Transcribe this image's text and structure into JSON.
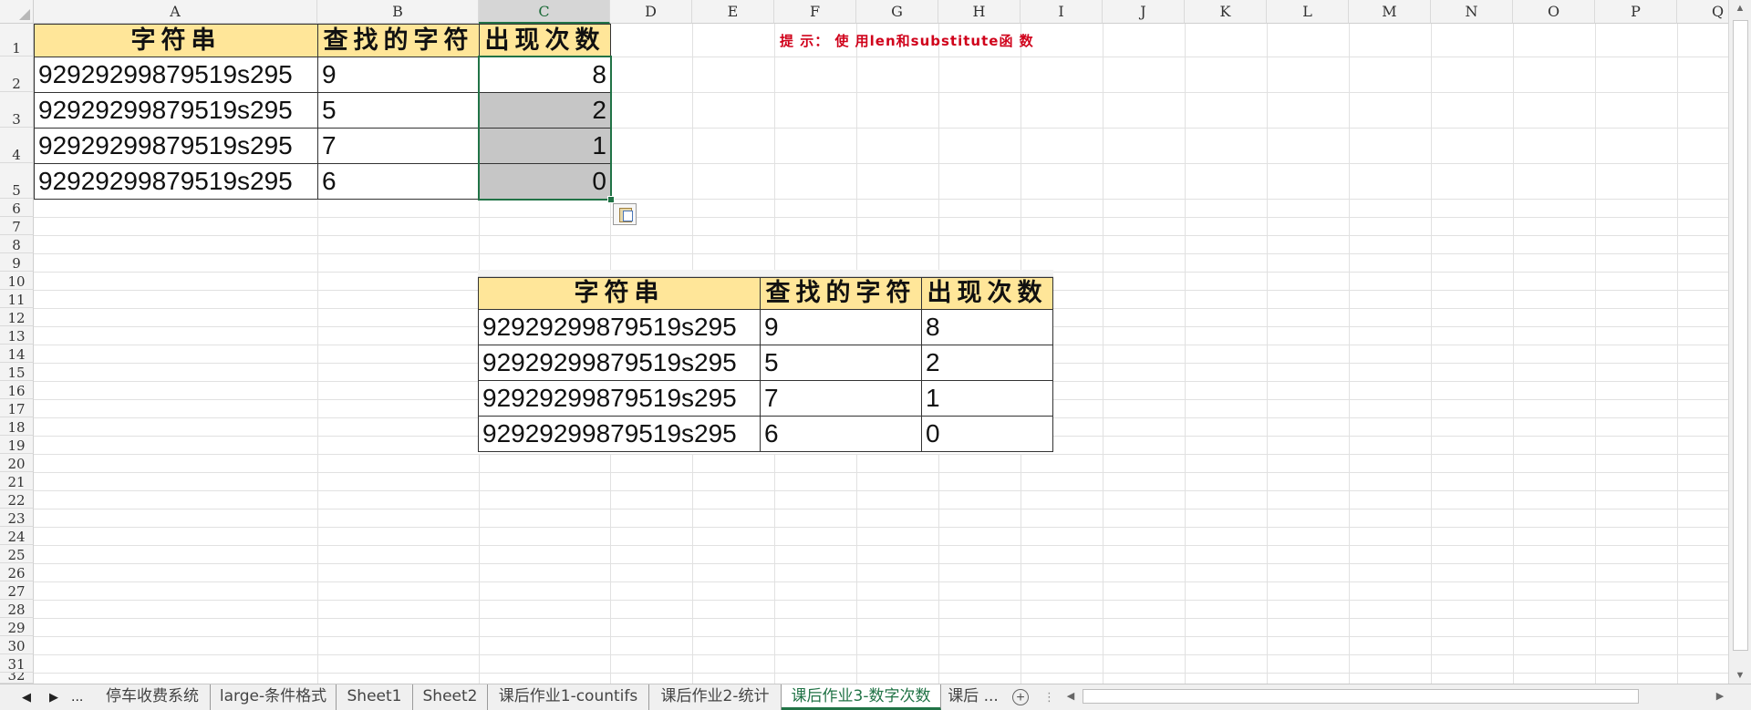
{
  "columns": [
    "A",
    "B",
    "C",
    "D",
    "E",
    "F",
    "G",
    "H",
    "I",
    "J",
    "K",
    "L",
    "M",
    "N",
    "O",
    "P",
    "Q"
  ],
  "rows": [
    "1",
    "2",
    "3",
    "4",
    "5",
    "6",
    "7",
    "8",
    "9",
    "10",
    "11",
    "12",
    "13",
    "14",
    "15",
    "16",
    "17",
    "18",
    "19",
    "20",
    "21",
    "22",
    "23",
    "24",
    "25",
    "26",
    "27",
    "28",
    "29",
    "30",
    "31",
    "32"
  ],
  "hint": "提 示： 使 用len和substitute函 数",
  "table1": {
    "headers": [
      "字符串",
      "查找的字符",
      "出现次数"
    ],
    "rows": [
      [
        "92929299879519s295",
        "9",
        "8"
      ],
      [
        "92929299879519s295",
        "5",
        "2"
      ],
      [
        "92929299879519s295",
        "7",
        "1"
      ],
      [
        "92929299879519s295",
        "6",
        "0"
      ]
    ]
  },
  "table2": {
    "headers": [
      "字符串",
      "查找的字符",
      "出现次数"
    ],
    "rows": [
      [
        "92929299879519s295",
        "9",
        "8"
      ],
      [
        "92929299879519s295",
        "5",
        "2"
      ],
      [
        "92929299879519s295",
        "7",
        "1"
      ],
      [
        "92929299879519s295",
        "6",
        "0"
      ]
    ]
  },
  "tabs": {
    "ellipsis": "...",
    "items": [
      "停车收费系统",
      "large-条件格式",
      "Sheet1",
      "Sheet2",
      "课后作业1-countifs",
      "课后作业2-统计",
      "课后作业3-数字次数",
      "课后 ..."
    ],
    "active_index": 6
  },
  "colors": {
    "header_fill": "#ffe699",
    "accent": "#217346",
    "hint": "#d0021b"
  }
}
